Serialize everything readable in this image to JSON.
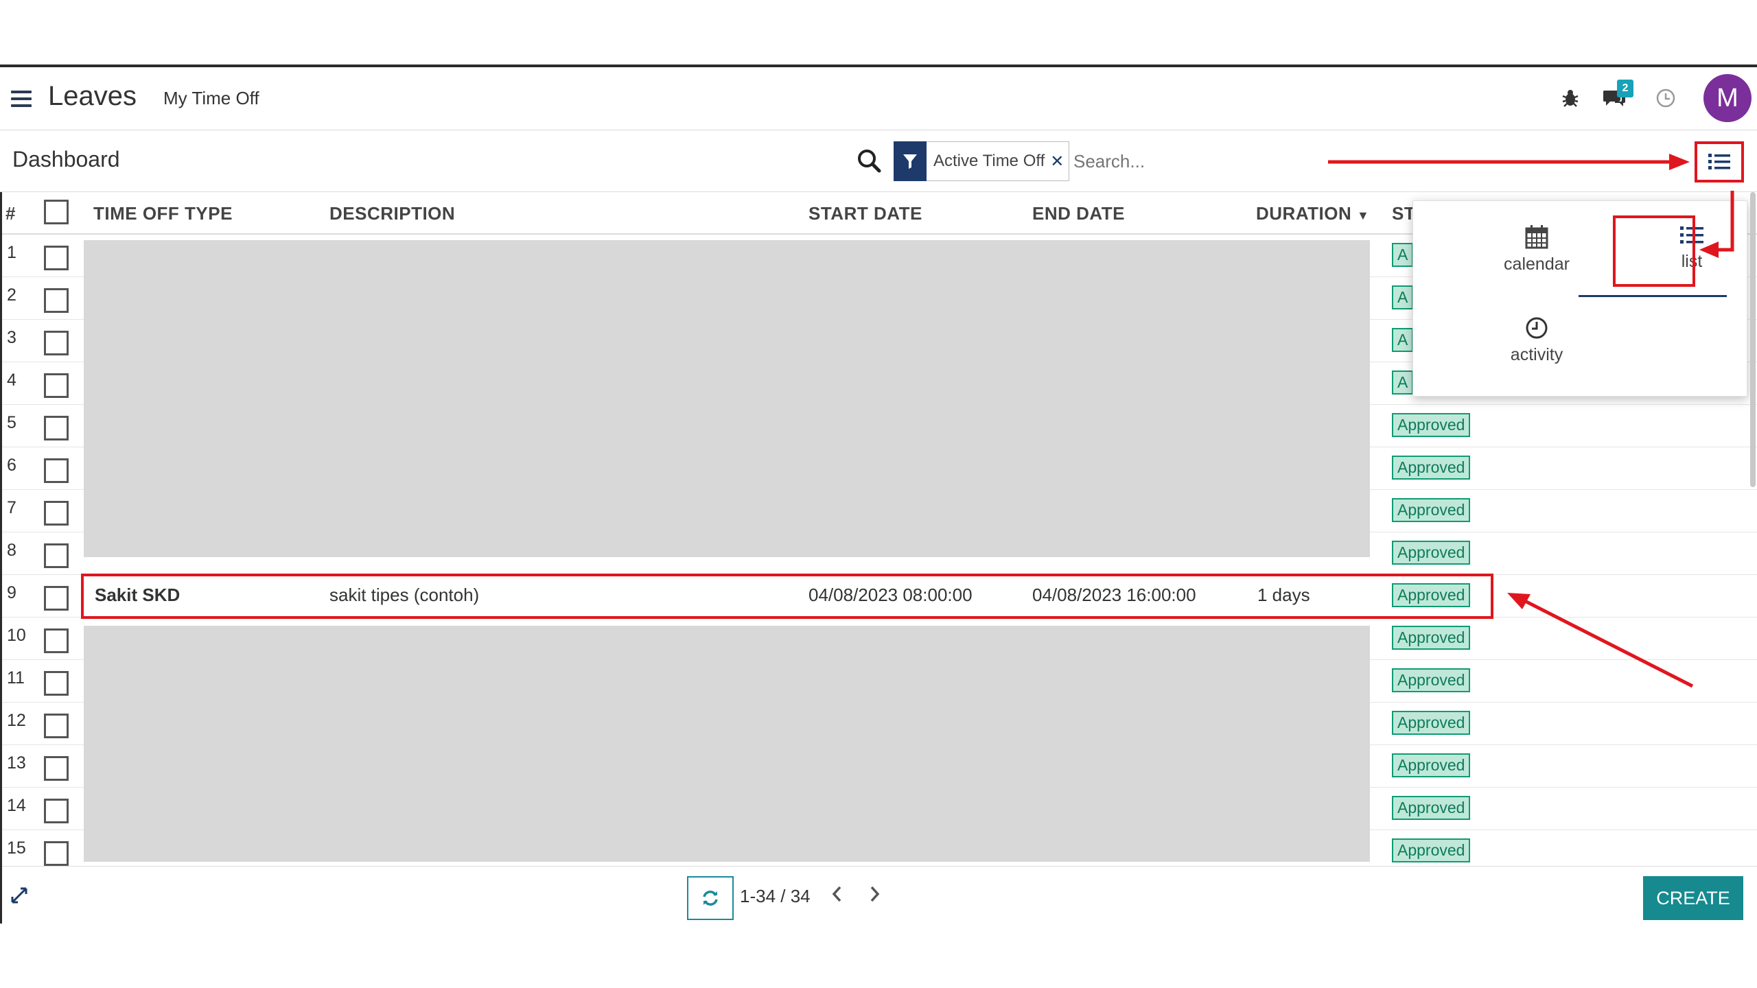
{
  "app": {
    "title": "Leaves",
    "nav_link": "My Time Off",
    "messages_count": "2",
    "avatar_letter": "M"
  },
  "control": {
    "breadcrumb": "Dashboard",
    "facet_label": "Active Time Off",
    "search_placeholder": "Search..."
  },
  "table": {
    "headers": {
      "num": "#",
      "type": "TIME OFF TYPE",
      "description": "DESCRIPTION",
      "start": "START DATE",
      "end": "END DATE",
      "duration": "DURATION",
      "status": "ST"
    },
    "rows": [
      {
        "num": "1",
        "status": "A"
      },
      {
        "num": "2",
        "status": "A"
      },
      {
        "num": "3",
        "status": "A"
      },
      {
        "num": "4",
        "status": "A"
      },
      {
        "num": "5",
        "status": "Approved"
      },
      {
        "num": "6",
        "status": "Approved"
      },
      {
        "num": "7",
        "status": "Approved"
      },
      {
        "num": "8",
        "status": "Approved"
      },
      {
        "num": "9",
        "type": "Sakit SKD",
        "description": "sakit tipes (contoh)",
        "start": "04/08/2023 08:00:00",
        "end": "04/08/2023 16:00:00",
        "duration": "1 days",
        "status": "Approved"
      },
      {
        "num": "10",
        "status": "Approved"
      },
      {
        "num": "11",
        "status": "Approved"
      },
      {
        "num": "12",
        "status": "Approved"
      },
      {
        "num": "13",
        "status": "Approved"
      },
      {
        "num": "14",
        "status": "Approved"
      },
      {
        "num": "15",
        "status": "Approved"
      }
    ]
  },
  "view_switcher": {
    "calendar": "calendar",
    "list": "list",
    "activity": "activity"
  },
  "footer": {
    "pager": "1-34 / 34",
    "create": "CREATE"
  },
  "colors": {
    "annotation_red": "#e0161e",
    "primary_navy": "#1d3a6b",
    "create_teal": "#168a8f",
    "status_green": "#0f9b73"
  }
}
